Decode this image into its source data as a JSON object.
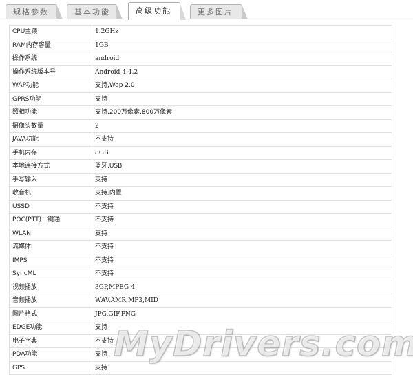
{
  "tabs": [
    {
      "label": "规格参数"
    },
    {
      "label": "基本功能"
    },
    {
      "label": "高级功能"
    },
    {
      "label": "更多图片"
    }
  ],
  "active_tab": "高级功能",
  "specs": [
    {
      "key": "CPU主频",
      "value": "1.2GHz"
    },
    {
      "key": "RAM内存容量",
      "value": "1GB"
    },
    {
      "key": "操作系统",
      "value": "android"
    },
    {
      "key": "操作系统版本号",
      "value": "Android 4.4.2"
    },
    {
      "key": "WAP功能",
      "value": "支持,Wap 2.0"
    },
    {
      "key": "GPRS功能",
      "value": "支持"
    },
    {
      "key": "照相功能",
      "value": "支持,200万像素,800万像素"
    },
    {
      "key": "摄像头数量",
      "value": "2"
    },
    {
      "key": "JAVA功能",
      "value": "不支持"
    },
    {
      "key": "手机内存",
      "value": "8GB"
    },
    {
      "key": "本地连接方式",
      "value": "蓝牙,USB"
    },
    {
      "key": "手写输入",
      "value": "支持"
    },
    {
      "key": "收音机",
      "value": "支持,内置"
    },
    {
      "key": "USSD",
      "value": "不支持"
    },
    {
      "key": "POC(PTT)一键通",
      "value": "不支持"
    },
    {
      "key": "WLAN",
      "value": "支持"
    },
    {
      "key": "流媒体",
      "value": "不支持"
    },
    {
      "key": "IMPS",
      "value": "不支持"
    },
    {
      "key": "SyncML",
      "value": "不支持"
    },
    {
      "key": "视频播放",
      "value": "3GP,MPEG-4"
    },
    {
      "key": "音频播放",
      "value": "WAV,AMR,MP3,MID"
    },
    {
      "key": "图片格式",
      "value": "JPG,GIF,PNG"
    },
    {
      "key": "EDGE功能",
      "value": "支持"
    },
    {
      "key": "电子字典",
      "value": "不支持"
    },
    {
      "key": "PDA功能",
      "value": "支持"
    },
    {
      "key": "GPS",
      "value": "支持"
    }
  ],
  "watermark": "MyDrivers.com"
}
